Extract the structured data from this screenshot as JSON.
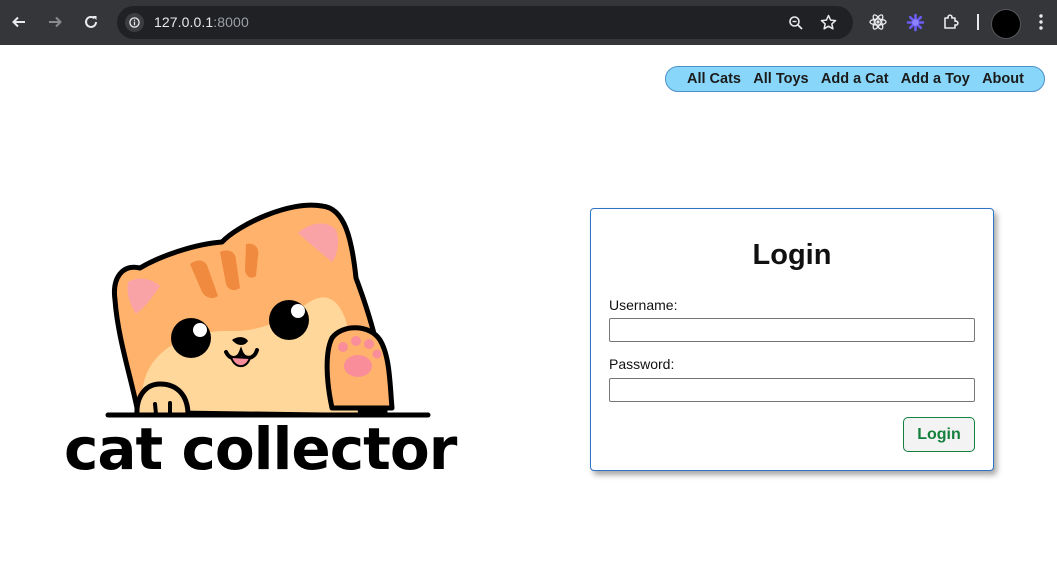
{
  "browser": {
    "url_host": "127.0.0.1",
    "url_port": ":8000",
    "icons": [
      "back-icon",
      "forward-icon",
      "reload-icon",
      "site-info-icon",
      "zoom-icon",
      "bookmark-star-icon",
      "react-devtools-icon",
      "extension-icon",
      "puzzle-icon",
      "profile-avatar",
      "menu-icon"
    ]
  },
  "nav": {
    "items": [
      {
        "label": "All Cats"
      },
      {
        "label": "All Toys"
      },
      {
        "label": "Add a Cat"
      },
      {
        "label": "Add a Toy"
      },
      {
        "label": "About"
      }
    ]
  },
  "logo": {
    "text": "cat collector"
  },
  "login": {
    "title": "Login",
    "username_label": "Username:",
    "username_value": "",
    "password_label": "Password:",
    "password_value": "",
    "submit_label": "Login"
  },
  "colors": {
    "nav_bg": "#88d7fb",
    "card_border": "#2f73c4",
    "login_button": "#15803d",
    "cat_orange": "#ffb26b",
    "cat_cream": "#ffd79a"
  }
}
